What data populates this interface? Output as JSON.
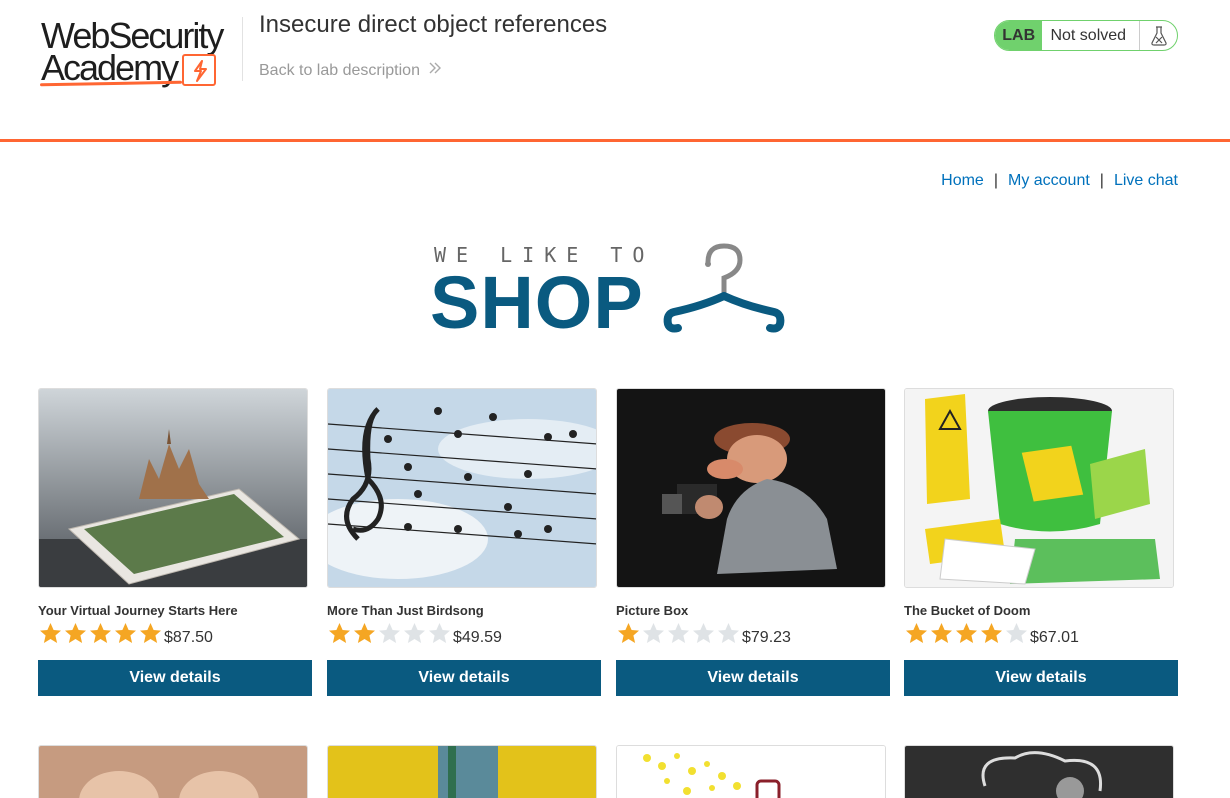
{
  "header": {
    "logo_line1": "WebSecurity",
    "logo_line2": "Academy",
    "lab_title": "Insecure direct object references",
    "back_link": "Back to lab description",
    "lab_badge": "LAB",
    "lab_status": "Not solved"
  },
  "nav": {
    "home": "Home",
    "my_account": "My account",
    "live_chat": "Live chat",
    "separator": "|"
  },
  "banner": {
    "tagline": "WE LIKE TO",
    "title": "SHOP"
  },
  "products": [
    {
      "name": "Your Virtual Journey Starts Here",
      "rating": 5,
      "price": "$87.50",
      "button": "View details"
    },
    {
      "name": "More Than Just Birdsong",
      "rating": 2,
      "price": "$49.59",
      "button": "View details"
    },
    {
      "name": "Picture Box",
      "rating": 1,
      "price": "$79.23",
      "button": "View details"
    },
    {
      "name": "The Bucket of Doom",
      "rating": 4,
      "price": "$67.01",
      "button": "View details"
    }
  ],
  "colors": {
    "accent_orange": "#ff6633",
    "button_blue": "#0a5a80",
    "link_blue": "#0071bc",
    "lab_green": "#70d16d",
    "star_gold": "#f5a623",
    "star_grey": "#dfe3e6"
  }
}
